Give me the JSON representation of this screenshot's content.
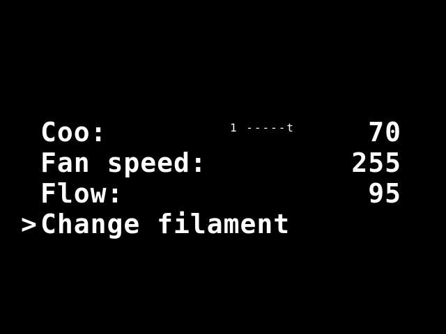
{
  "menu": {
    "items": [
      {
        "cursor": "",
        "label": "Coo:",
        "hint": "1 -----t",
        "value": "70"
      },
      {
        "cursor": "",
        "label": "Fan speed:",
        "hint": "",
        "value": "255"
      },
      {
        "cursor": "",
        "label": "Flow:",
        "hint": "",
        "value": "95"
      },
      {
        "cursor": ">",
        "label": "Change filament",
        "hint": "",
        "value": ""
      }
    ]
  },
  "colors": {
    "background": "#000000",
    "foreground": "#ffffff"
  }
}
